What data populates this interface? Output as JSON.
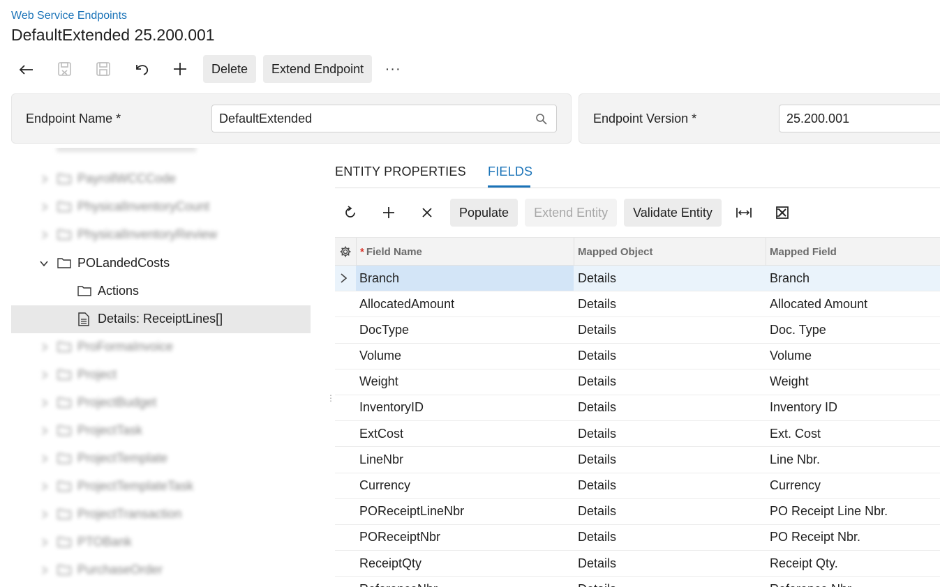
{
  "header": {
    "breadcrumb": "Web Service Endpoints",
    "title": "DefaultExtended 25.200.001"
  },
  "toolbar": {
    "icons": [
      "back-icon",
      "save-close-icon",
      "save-icon",
      "undo-icon",
      "add-icon"
    ],
    "delete_label": "Delete",
    "extend_endpoint_label": "Extend Endpoint",
    "more_label": "···"
  },
  "form": {
    "endpoint_name_label": "Endpoint Name *",
    "endpoint_name_value": "DefaultExtended",
    "endpoint_version_label": "Endpoint Version *",
    "endpoint_version_value": "25.200.001"
  },
  "tree": {
    "blurred_above": [
      "PayrollWCCCode",
      "PhysicalInventoryCount",
      "PhysicalInventoryReview"
    ],
    "expanded_node": "POLandedCosts",
    "children": [
      "Actions",
      "Details: ReceiptLines[]"
    ],
    "selected_child": "Details: ReceiptLines[]",
    "blurred_below": [
      "ProFormaInvoice",
      "Project",
      "ProjectBudget",
      "ProjectTask",
      "ProjectTemplate",
      "ProjectTemplateTask",
      "ProjectTransaction",
      "PTOBank",
      "PurchaseOrder"
    ]
  },
  "tabs": [
    {
      "label": "ENTITY PROPERTIES",
      "active": false
    },
    {
      "label": "FIELDS",
      "active": true
    }
  ],
  "grid_toolbar": {
    "icons": [
      "refresh-icon",
      "add-icon",
      "delete-icon",
      "fit-columns-icon",
      "export-excel-icon"
    ],
    "populate_label": "Populate",
    "extend_entity_label": "Extend Entity",
    "validate_entity_label": "Validate Entity"
  },
  "grid": {
    "columns": {
      "required_mark": "*",
      "field_name": "Field Name",
      "mapped_object": "Mapped Object",
      "mapped_field": "Mapped Field"
    },
    "rows": [
      {
        "field_name": "Branch",
        "mapped_object": "Details",
        "mapped_field": "Branch"
      },
      {
        "field_name": "AllocatedAmount",
        "mapped_object": "Details",
        "mapped_field": "Allocated Amount"
      },
      {
        "field_name": "DocType",
        "mapped_object": "Details",
        "mapped_field": "Doc. Type"
      },
      {
        "field_name": "Volume",
        "mapped_object": "Details",
        "mapped_field": "Volume"
      },
      {
        "field_name": "Weight",
        "mapped_object": "Details",
        "mapped_field": "Weight"
      },
      {
        "field_name": "InventoryID",
        "mapped_object": "Details",
        "mapped_field": "Inventory ID"
      },
      {
        "field_name": "ExtCost",
        "mapped_object": "Details",
        "mapped_field": "Ext. Cost"
      },
      {
        "field_name": "LineNbr",
        "mapped_object": "Details",
        "mapped_field": "Line Nbr."
      },
      {
        "field_name": "Currency",
        "mapped_object": "Details",
        "mapped_field": "Currency"
      },
      {
        "field_name": "POReceiptLineNbr",
        "mapped_object": "Details",
        "mapped_field": "PO Receipt Line Nbr."
      },
      {
        "field_name": "POReceiptNbr",
        "mapped_object": "Details",
        "mapped_field": "PO Receipt Nbr."
      },
      {
        "field_name": "ReceiptQty",
        "mapped_object": "Details",
        "mapped_field": "Receipt Qty."
      },
      {
        "field_name": "ReferenceNbr",
        "mapped_object": "Details",
        "mapped_field": "Reference Nbr."
      }
    ]
  },
  "colors": {
    "accent": "#1a73b8",
    "selected_row": "#d3e5f7",
    "required": "#d9342b"
  }
}
